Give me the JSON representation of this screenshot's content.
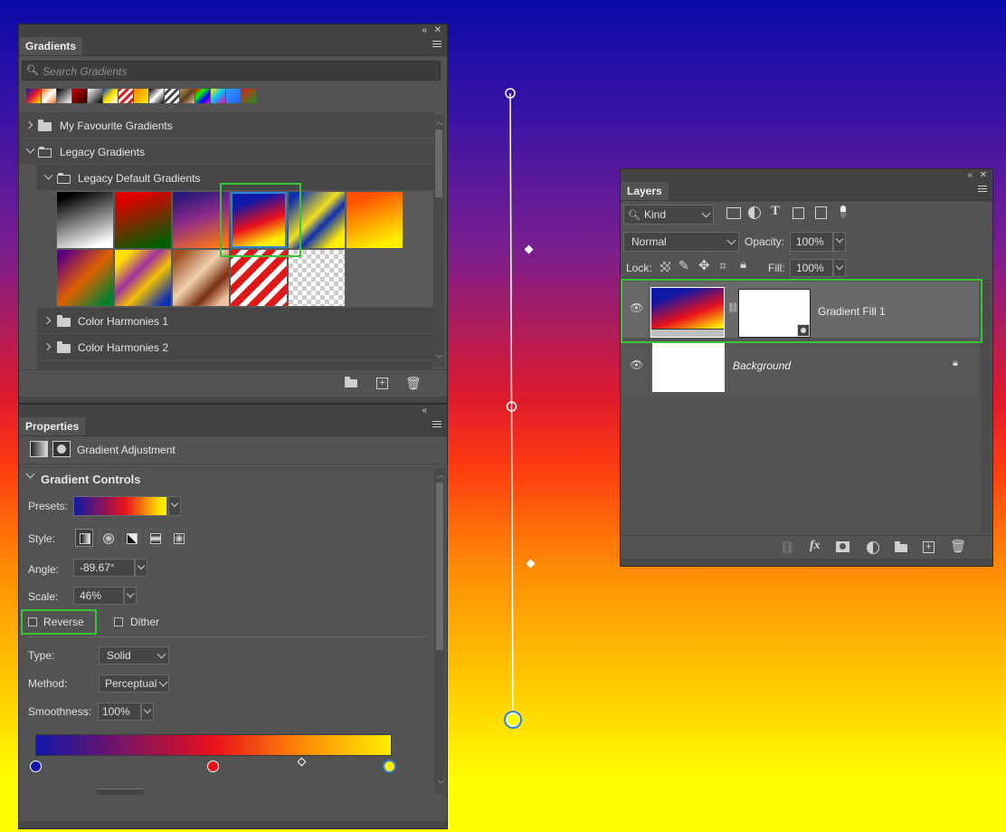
{
  "colors": {
    "accent_green": "#35c635",
    "panel_bg": "#535353",
    "handle_blue": "#2f84d6"
  },
  "gradients_panel": {
    "tab": "Gradients",
    "search_placeholder": "Search Gradients",
    "folders": [
      {
        "label": "My Favourite Gradients",
        "expanded": false
      },
      {
        "label": "Legacy Gradients",
        "expanded": true
      },
      {
        "label": "Legacy Default Gradients",
        "expanded": true
      },
      {
        "label": "Color Harmonies 1",
        "expanded": false
      },
      {
        "label": "Color Harmonies 2",
        "expanded": false
      }
    ],
    "footer_icons": [
      "new-group-icon",
      "new-gradient-icon",
      "trash-icon"
    ]
  },
  "properties_panel": {
    "tab": "Properties",
    "title": "Gradient Adjustment",
    "section": "Gradient Controls",
    "presets_label": "Presets:",
    "style_label": "Style:",
    "angle_label": "Angle:",
    "angle_value": "-89.67°",
    "scale_label": "Scale:",
    "scale_value": "46%",
    "reverse_label": "Reverse",
    "dither_label": "Dither",
    "reverse_checked": false,
    "dither_checked": false,
    "type_label": "Type:",
    "type_value": "Solid",
    "method_label": "Method:",
    "method_value": "Perceptual",
    "smoothness_label": "Smoothness:",
    "smoothness_value": "100%"
  },
  "layers_panel": {
    "tab": "Layers",
    "filter_kind": "Kind",
    "blend_mode": "Normal",
    "opacity_label": "Opacity:",
    "opacity_value": "100%",
    "lock_label": "Lock:",
    "fill_label": "Fill:",
    "fill_value": "100%",
    "layers": [
      {
        "name": "Gradient Fill 1",
        "selected": true,
        "visible": true
      },
      {
        "name": "Background",
        "selected": false,
        "visible": true,
        "locked": true
      }
    ],
    "footer_icons": [
      "link-icon",
      "fx-icon",
      "mask-icon",
      "adjustment-icon",
      "group-icon",
      "new-layer-icon",
      "trash-icon"
    ]
  }
}
